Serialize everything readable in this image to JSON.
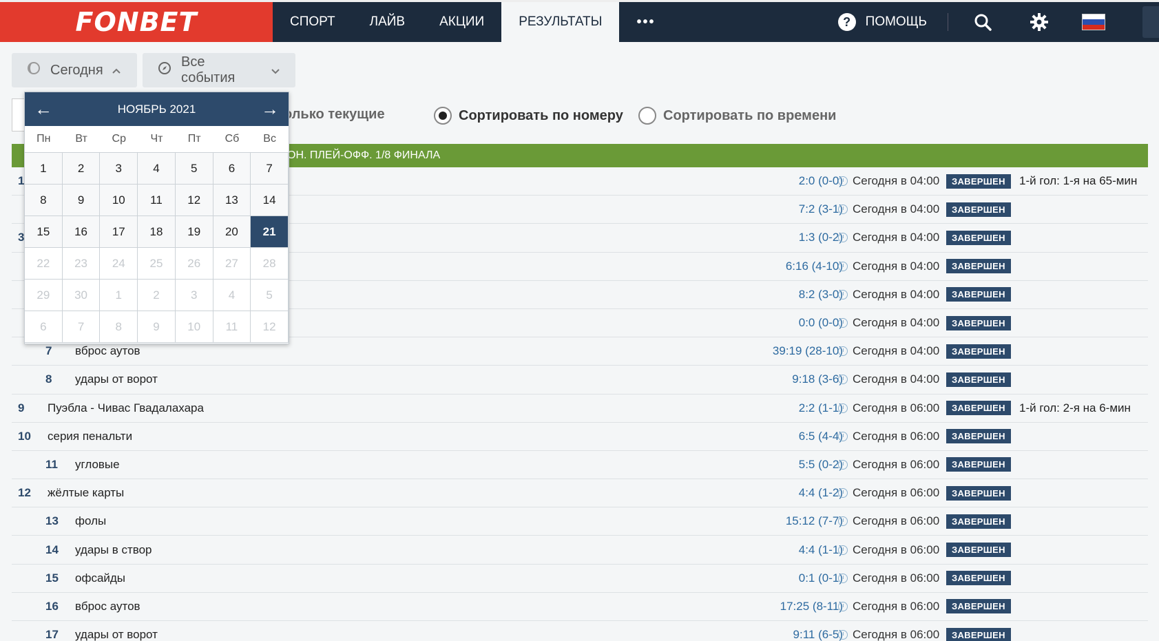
{
  "header": {
    "logo": "FONBET",
    "nav": [
      {
        "label": "СПОРТ"
      },
      {
        "label": "ЛАЙВ"
      },
      {
        "label": "АКЦИИ"
      },
      {
        "label": "РЕЗУЛЬТАТЫ",
        "active": true
      }
    ],
    "more": "•••",
    "help_icon": "?",
    "help_label": "ПОМОЩЬ",
    "icons": [
      "search-icon",
      "gear-icon",
      "flag-ru-icon"
    ]
  },
  "filters": {
    "date_label": "Сегодня",
    "events_label": "Все события",
    "only_current": "олько текущие",
    "sort_number": "Сортировать по номеру",
    "sort_time": "Сортировать по времени"
  },
  "league": {
    "title": "ОН. ПЛЕЙ-ОФФ. 1/8 ФИНАЛА"
  },
  "calendar": {
    "month": "НОЯБРЬ 2021",
    "prev": "←",
    "next": "→",
    "weekdays": [
      "Пн",
      "Вт",
      "Ср",
      "Чт",
      "Пт",
      "Сб",
      "Вс"
    ],
    "days": [
      "1",
      "2",
      "3",
      "4",
      "5",
      "6",
      "7",
      "8",
      "9",
      "10",
      "11",
      "12",
      "13",
      "14",
      "15",
      "16",
      "17",
      "18",
      "19",
      "20",
      "21",
      "22",
      "23",
      "24",
      "25",
      "26",
      "27",
      "28",
      "29",
      "30",
      "1",
      "2",
      "3",
      "4",
      "5",
      "6",
      "7",
      "8",
      "9",
      "10",
      "11",
      "12"
    ],
    "selected": "21"
  },
  "rows": [
    {
      "num": "1",
      "indent": false,
      "name": "",
      "score": "2:0 (0-0)",
      "time": "Сегодня в 04:00",
      "status": "ЗАВЕРШЕН",
      "comment": "1-й гол: 1-я на 65-мин"
    },
    {
      "num": "",
      "indent": true,
      "name": "",
      "score": "7:2 (3-1)",
      "time": "Сегодня в 04:00",
      "status": "ЗАВЕРШЕН",
      "comment": ""
    },
    {
      "num": "3",
      "indent": false,
      "name": "",
      "score": "1:3 (0-2)",
      "time": "Сегодня в 04:00",
      "status": "ЗАВЕРШЕН",
      "comment": ""
    },
    {
      "num": "",
      "indent": true,
      "name": "",
      "score": "6:16 (4-10)",
      "time": "Сегодня в 04:00",
      "status": "ЗАВЕРШЕН",
      "comment": ""
    },
    {
      "num": "",
      "indent": true,
      "name": "",
      "score": "8:2 (3-0)",
      "time": "Сегодня в 04:00",
      "status": "ЗАВЕРШЕН",
      "comment": ""
    },
    {
      "num": "",
      "indent": true,
      "name": "",
      "score": "0:0 (0-0)",
      "time": "Сегодня в 04:00",
      "status": "ЗАВЕРШЕН",
      "comment": ""
    },
    {
      "num": "7",
      "indent": true,
      "name": "вброс аутов",
      "score": "39:19 (28-10)",
      "time": "Сегодня в 04:00",
      "status": "ЗАВЕРШЕН",
      "comment": ""
    },
    {
      "num": "8",
      "indent": true,
      "name": "удары от ворот",
      "score": "9:18 (3-6)",
      "time": "Сегодня в 04:00",
      "status": "ЗАВЕРШЕН",
      "comment": ""
    },
    {
      "num": "9",
      "indent": false,
      "name": "Пуэбла - Чивас Гвадалахара",
      "score": "2:2 (1-1)",
      "time": "Сегодня в 06:00",
      "status": "ЗАВЕРШЕН",
      "comment": "1-й гол: 2-я на 6-мин"
    },
    {
      "num": "10",
      "indent": false,
      "name": "серия пенальти",
      "score": "6:5 (4-4)",
      "time": "Сегодня в 06:00",
      "status": "ЗАВЕРШЕН",
      "comment": ""
    },
    {
      "num": "11",
      "indent": true,
      "name": "угловые",
      "score": "5:5 (0-2)",
      "time": "Сегодня в 06:00",
      "status": "ЗАВЕРШЕН",
      "comment": ""
    },
    {
      "num": "12",
      "indent": false,
      "name": "жёлтые карты",
      "score": "4:4 (1-2)",
      "time": "Сегодня в 06:00",
      "status": "ЗАВЕРШЕН",
      "comment": ""
    },
    {
      "num": "13",
      "indent": true,
      "name": "фолы",
      "score": "15:12 (7-7)",
      "time": "Сегодня в 06:00",
      "status": "ЗАВЕРШЕН",
      "comment": ""
    },
    {
      "num": "14",
      "indent": true,
      "name": "удары в створ",
      "score": "4:4 (1-1)",
      "time": "Сегодня в 06:00",
      "status": "ЗАВЕРШЕН",
      "comment": ""
    },
    {
      "num": "15",
      "indent": true,
      "name": "офсайды",
      "score": "0:1 (0-1)",
      "time": "Сегодня в 06:00",
      "status": "ЗАВЕРШЕН",
      "comment": ""
    },
    {
      "num": "16",
      "indent": true,
      "name": "вброс аутов",
      "score": "17:25 (8-11)",
      "time": "Сегодня в 06:00",
      "status": "ЗАВЕРШЕН",
      "comment": ""
    },
    {
      "num": "17",
      "indent": true,
      "name": "удары от ворот",
      "score": "9:11 (6-5)",
      "time": "Сегодня в 06:00",
      "status": "ЗАВЕРШЕН",
      "comment": ""
    }
  ],
  "colors": {
    "brand_red": "#e23a2d",
    "navy": "#1c2b3d",
    "league_green": "#6a9a37",
    "badge_blue": "#2d4a6b"
  }
}
